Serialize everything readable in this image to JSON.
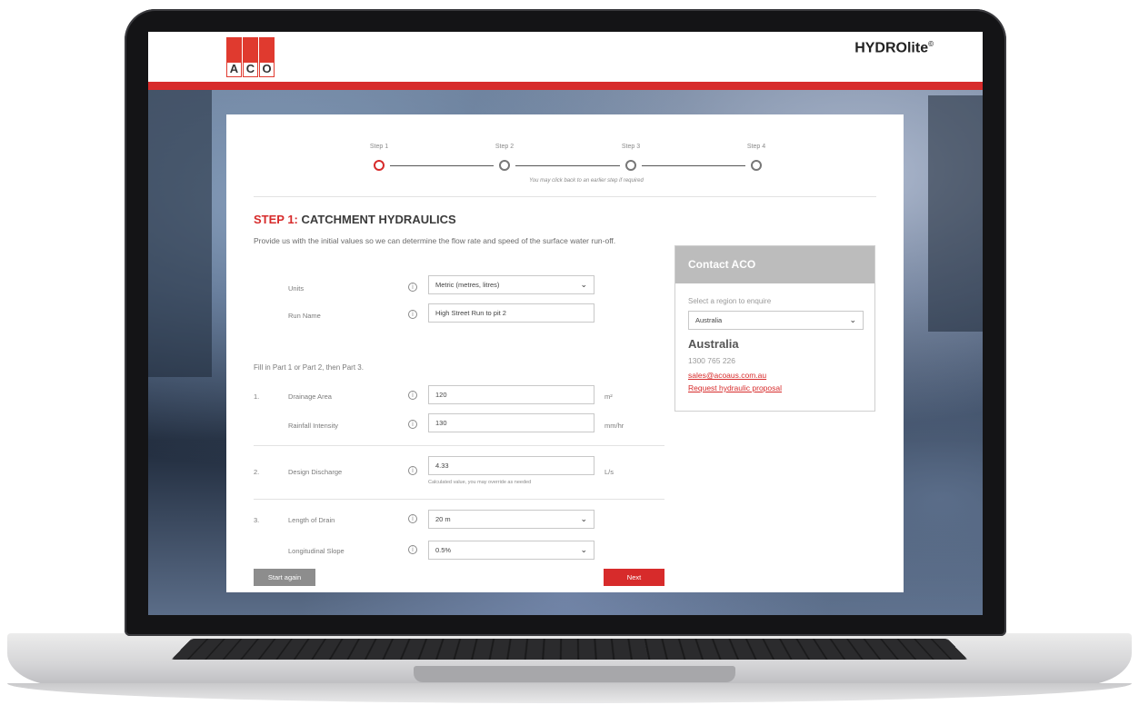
{
  "brand": {
    "logo_letters": [
      "A",
      "C",
      "O"
    ],
    "product": "HYDROlite",
    "product_mark": "©",
    "accent": "#d72b2b"
  },
  "stepper": {
    "steps": [
      {
        "label": "Step 1",
        "active": true
      },
      {
        "label": "Step 2",
        "active": false
      },
      {
        "label": "Step 3",
        "active": false
      },
      {
        "label": "Step 4",
        "active": false
      }
    ],
    "hint": "You may click back to an earlier step if required"
  },
  "form": {
    "heading_prefix": "STEP 1:",
    "heading_title": "CATCHMENT HYDRAULICS",
    "intro": "Provide us with the initial values so we can determine the flow rate and speed of the surface water run-off.",
    "units": {
      "label": "Units",
      "value": "Metric (metres, litres)"
    },
    "run_name": {
      "label": "Run Name",
      "value": "High Street Run to pit 2"
    },
    "fill_note": "Fill in Part 1 or Part 2, then Part 3.",
    "drainage_area": {
      "number": "1.",
      "label": "Drainage Area",
      "value": "120",
      "unit": "m²"
    },
    "rainfall_intensity": {
      "label": "Rainfall Intensity",
      "value": "130",
      "unit": "mm/hr"
    },
    "design_discharge": {
      "number": "2.",
      "label": "Design Discharge",
      "value": "4.33",
      "unit": "L/s",
      "note": "Calculated value, you may override as needed"
    },
    "length_of_drain": {
      "number": "3.",
      "label": "Length of Drain",
      "value": "20 m"
    },
    "longitudinal_slope": {
      "label": "Longitudinal Slope",
      "value": "0.5%"
    },
    "info_icon": "info-icon",
    "start_again_label": "Start again",
    "next_label": "Next"
  },
  "contact": {
    "title": "Contact ACO",
    "prompt": "Select a region to enquire",
    "region_select": "Australia",
    "region_name": "Australia",
    "phone": "1300 765 226",
    "email": "sales@acoaus.com.au",
    "proposal_link": "Request hydraulic proposal"
  }
}
